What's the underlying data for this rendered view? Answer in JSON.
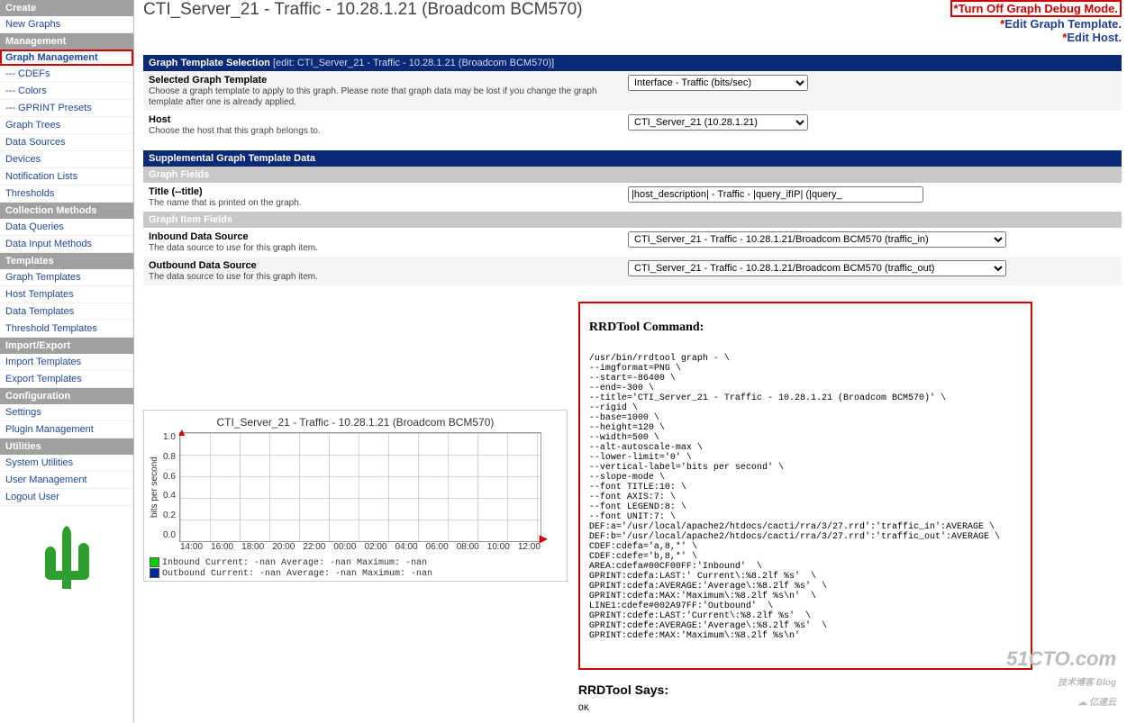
{
  "sidebar": {
    "sections": [
      {
        "header": "Create",
        "items": [
          {
            "label": "New Graphs"
          }
        ]
      },
      {
        "header": "Management",
        "items": [
          {
            "label": "Graph Management",
            "selected": true
          },
          {
            "label": "--- CDEFs"
          },
          {
            "label": "--- Colors"
          },
          {
            "label": "--- GPRINT Presets"
          },
          {
            "label": "Graph Trees"
          },
          {
            "label": "Data Sources"
          },
          {
            "label": "Devices"
          },
          {
            "label": "Notification Lists"
          },
          {
            "label": "Thresholds"
          }
        ]
      },
      {
        "header": "Collection Methods",
        "items": [
          {
            "label": "Data Queries"
          },
          {
            "label": "Data Input Methods"
          }
        ]
      },
      {
        "header": "Templates",
        "items": [
          {
            "label": "Graph Templates"
          },
          {
            "label": "Host Templates"
          },
          {
            "label": "Data Templates"
          },
          {
            "label": "Threshold Templates"
          }
        ]
      },
      {
        "header": "Import/Export",
        "items": [
          {
            "label": "Import Templates"
          },
          {
            "label": "Export Templates"
          }
        ]
      },
      {
        "header": "Configuration",
        "items": [
          {
            "label": "Settings"
          },
          {
            "label": "Plugin Management"
          }
        ]
      },
      {
        "header": "Utilities",
        "items": [
          {
            "label": "System Utilities"
          },
          {
            "label": "User Management"
          },
          {
            "label": "Logout User"
          }
        ]
      }
    ]
  },
  "page_title": "CTI_Server_21 - Traffic - 10.28.1.21 (Broadcom BCM570)",
  "toplinks": {
    "debug": "Turn Off Graph Debug Mode.",
    "edit_template": "Edit Graph Template.",
    "edit_host": "Edit Host."
  },
  "gts": {
    "bar_title": "Graph Template Selection",
    "bar_edit": "[edit: CTI_Server_21 - Traffic - 10.28.1.21 (Broadcom BCM570)]",
    "sgt_label": "Selected Graph Template",
    "sgt_help": "Choose a graph template to apply to this graph. Please note that graph data may be lost if you change the graph template after one is already applied.",
    "sgt_value": "Interface - Traffic (bits/sec)",
    "host_label": "Host",
    "host_help": "Choose the host that this graph belongs to.",
    "host_value": "CTI_Server_21 (10.28.1.21)"
  },
  "supp": {
    "bar": "Supplemental Graph Template Data",
    "fields_bar": "Graph Fields",
    "title_label": "Title (--title)",
    "title_help": "The name that is printed on the graph.",
    "title_value": "|host_description| - Traffic - |query_ifIP| (|query_",
    "items_bar": "Graph Item Fields",
    "in_label": "Inbound Data Source",
    "in_help": "The data source to use for this graph item.",
    "in_value": "CTI_Server_21 - Traffic - 10.28.1.21/Broadcom BCM570 (traffic_in)",
    "out_label": "Outbound Data Source",
    "out_help": "The data source to use for this graph item.",
    "out_value": "CTI_Server_21 - Traffic - 10.28.1.21/Broadcom BCM570 (traffic_out)"
  },
  "chart_data": {
    "type": "line",
    "title": "CTI_Server_21 - Traffic - 10.28.1.21 (Broadcom BCM570)",
    "ylabel": "bits per second",
    "ylim": [
      0.0,
      1.0
    ],
    "yticks": [
      "1.0",
      "0.8",
      "0.6",
      "0.4",
      "0.2",
      "0.0"
    ],
    "x": [
      "14:00",
      "16:00",
      "18:00",
      "20:00",
      "22:00",
      "00:00",
      "02:00",
      "04:00",
      "06:00",
      "08:00",
      "10:00",
      "12:00"
    ],
    "series": [
      {
        "name": "Inbound",
        "color": "#00CF00",
        "values": [
          null,
          null,
          null,
          null,
          null,
          null,
          null,
          null,
          null,
          null,
          null,
          null
        ],
        "stats": {
          "Current": "-nan",
          "Average": "-nan",
          "Maximum": "-nan"
        }
      },
      {
        "name": "Outbound",
        "color": "#002A97",
        "values": [
          null,
          null,
          null,
          null,
          null,
          null,
          null,
          null,
          null,
          null,
          null,
          null
        ],
        "stats": {
          "Current": "-nan",
          "Average": "-nan",
          "Maximum": "-nan"
        }
      }
    ]
  },
  "legend": {
    "line1": "Inbound    Current:   -nan     Average:   -nan     Maximum:   -nan",
    "line2": "Outbound   Current:   -nan     Average:   -nan     Maximum:   -nan"
  },
  "rrd": {
    "title": "RRDTool Command:",
    "body": "/usr/bin/rrdtool graph - \\\n--imgformat=PNG \\\n--start=-86400 \\\n--end=-300 \\\n--title='CTI_Server_21 - Traffic - 10.28.1.21 (Broadcom BCM570)' \\\n--rigid \\\n--base=1000 \\\n--height=120 \\\n--width=500 \\\n--alt-autoscale-max \\\n--lower-limit='0' \\\n--vertical-label='bits per second' \\\n--slope-mode \\\n--font TITLE:10: \\\n--font AXIS:7: \\\n--font LEGEND:8: \\\n--font UNIT:7: \\\nDEF:a='/usr/local/apache2/htdocs/cacti/rra/3/27.rrd':'traffic_in':AVERAGE \\\nDEF:b='/usr/local/apache2/htdocs/cacti/rra/3/27.rrd':'traffic_out':AVERAGE \\\nCDEF:cdefa='a,8,*' \\\nCDEF:cdefe='b,8,*' \\\nAREA:cdefa#00CF00FF:'Inbound'  \\\nGPRINT:cdefa:LAST:' Current\\:%8.2lf %s'  \\\nGPRINT:cdefa:AVERAGE:'Average\\:%8.2lf %s'  \\\nGPRINT:cdefa:MAX:'Maximum\\:%8.2lf %s\\n'  \\\nLINE1:cdefe#002A97FF:'Outbound'  \\\nGPRINT:cdefe:LAST:'Current\\:%8.2lf %s'  \\\nGPRINT:cdefe:AVERAGE:'Average\\:%8.2lf %s'  \\\nGPRINT:cdefe:MAX:'Maximum\\:%8.2lf %s\\n'",
    "says_title": "RRDTool Says:",
    "says_value": "OK"
  },
  "watermark": {
    "big": "51CTO.com",
    "small": "技术博客  Blog",
    "sub": "亿速云"
  }
}
